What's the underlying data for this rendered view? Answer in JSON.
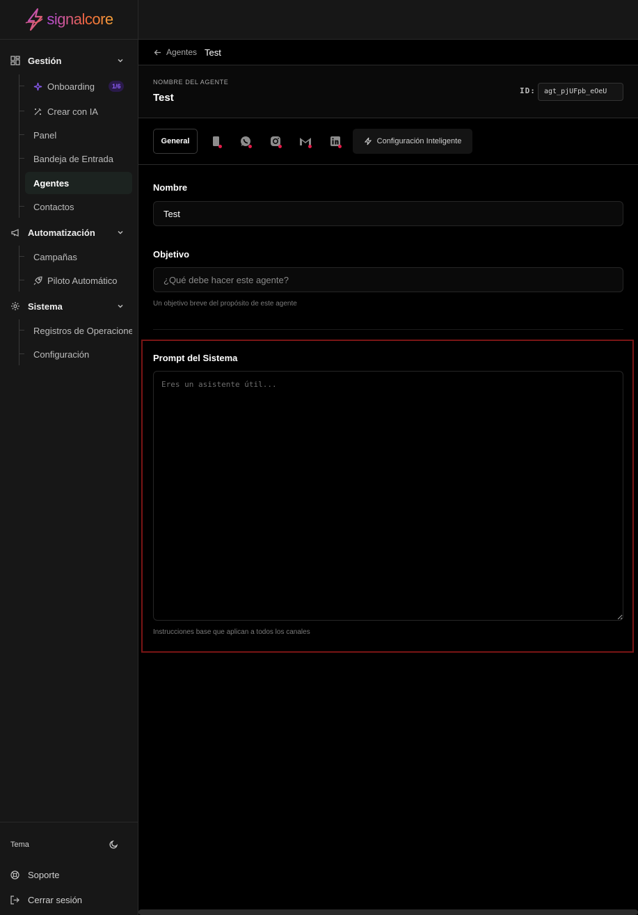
{
  "brand": {
    "name": "signalcore"
  },
  "sidebar": {
    "groups": [
      {
        "label": "Gestión",
        "icon": "dashboard-icon"
      },
      {
        "label": "Automatización",
        "icon": "megaphone-icon"
      },
      {
        "label": "Sistema",
        "icon": "gear-icon"
      }
    ],
    "items": {
      "onboarding": {
        "label": "Onboarding",
        "badge": "1/6",
        "icon": "sparkle-icon"
      },
      "crear_ia": {
        "label": "Crear con IA",
        "icon": "magic-wand-icon"
      },
      "panel": {
        "label": "Panel"
      },
      "bandeja": {
        "label": "Bandeja de Entrada"
      },
      "agentes": {
        "label": "Agentes"
      },
      "contactos": {
        "label": "Contactos"
      },
      "campanas": {
        "label": "Campañas"
      },
      "piloto": {
        "label": "Piloto Automático",
        "icon": "rocket-icon"
      },
      "registros": {
        "label": "Registros de Operacione"
      },
      "configuracion": {
        "label": "Configuración"
      }
    },
    "bottom": {
      "theme_label": "Tema",
      "support_label": "Soporte",
      "logout_label": "Cerrar sesión"
    }
  },
  "breadcrumb": {
    "back_label": "Agentes",
    "current": "Test"
  },
  "agent": {
    "name_caption": "NOMBRE DEL AGENTE",
    "name": "Test",
    "id_label": "ID:",
    "id_value": "agt_pjUFpb_eOeU"
  },
  "tabs": {
    "general": "General",
    "channels": [
      "phone-icon",
      "whatsapp-icon",
      "instagram-icon",
      "gmail-icon",
      "linkedin-icon"
    ],
    "smart_config": "Configuración Inteligente"
  },
  "form": {
    "nombre": {
      "label": "Nombre",
      "value": "Test"
    },
    "objetivo": {
      "label": "Objetivo",
      "placeholder": "¿Qué debe hacer este agente?",
      "hint": "Un objetivo breve del propósito de este agente"
    },
    "prompt": {
      "label": "Prompt del Sistema",
      "placeholder": "Eres un asistente útil...",
      "hint": "Instrucciones base que aplican a todos los canales"
    }
  },
  "colors": {
    "accent_purple": "#8b5cf6",
    "status_red": "#e11d48",
    "highlight_border": "#7a1515"
  }
}
